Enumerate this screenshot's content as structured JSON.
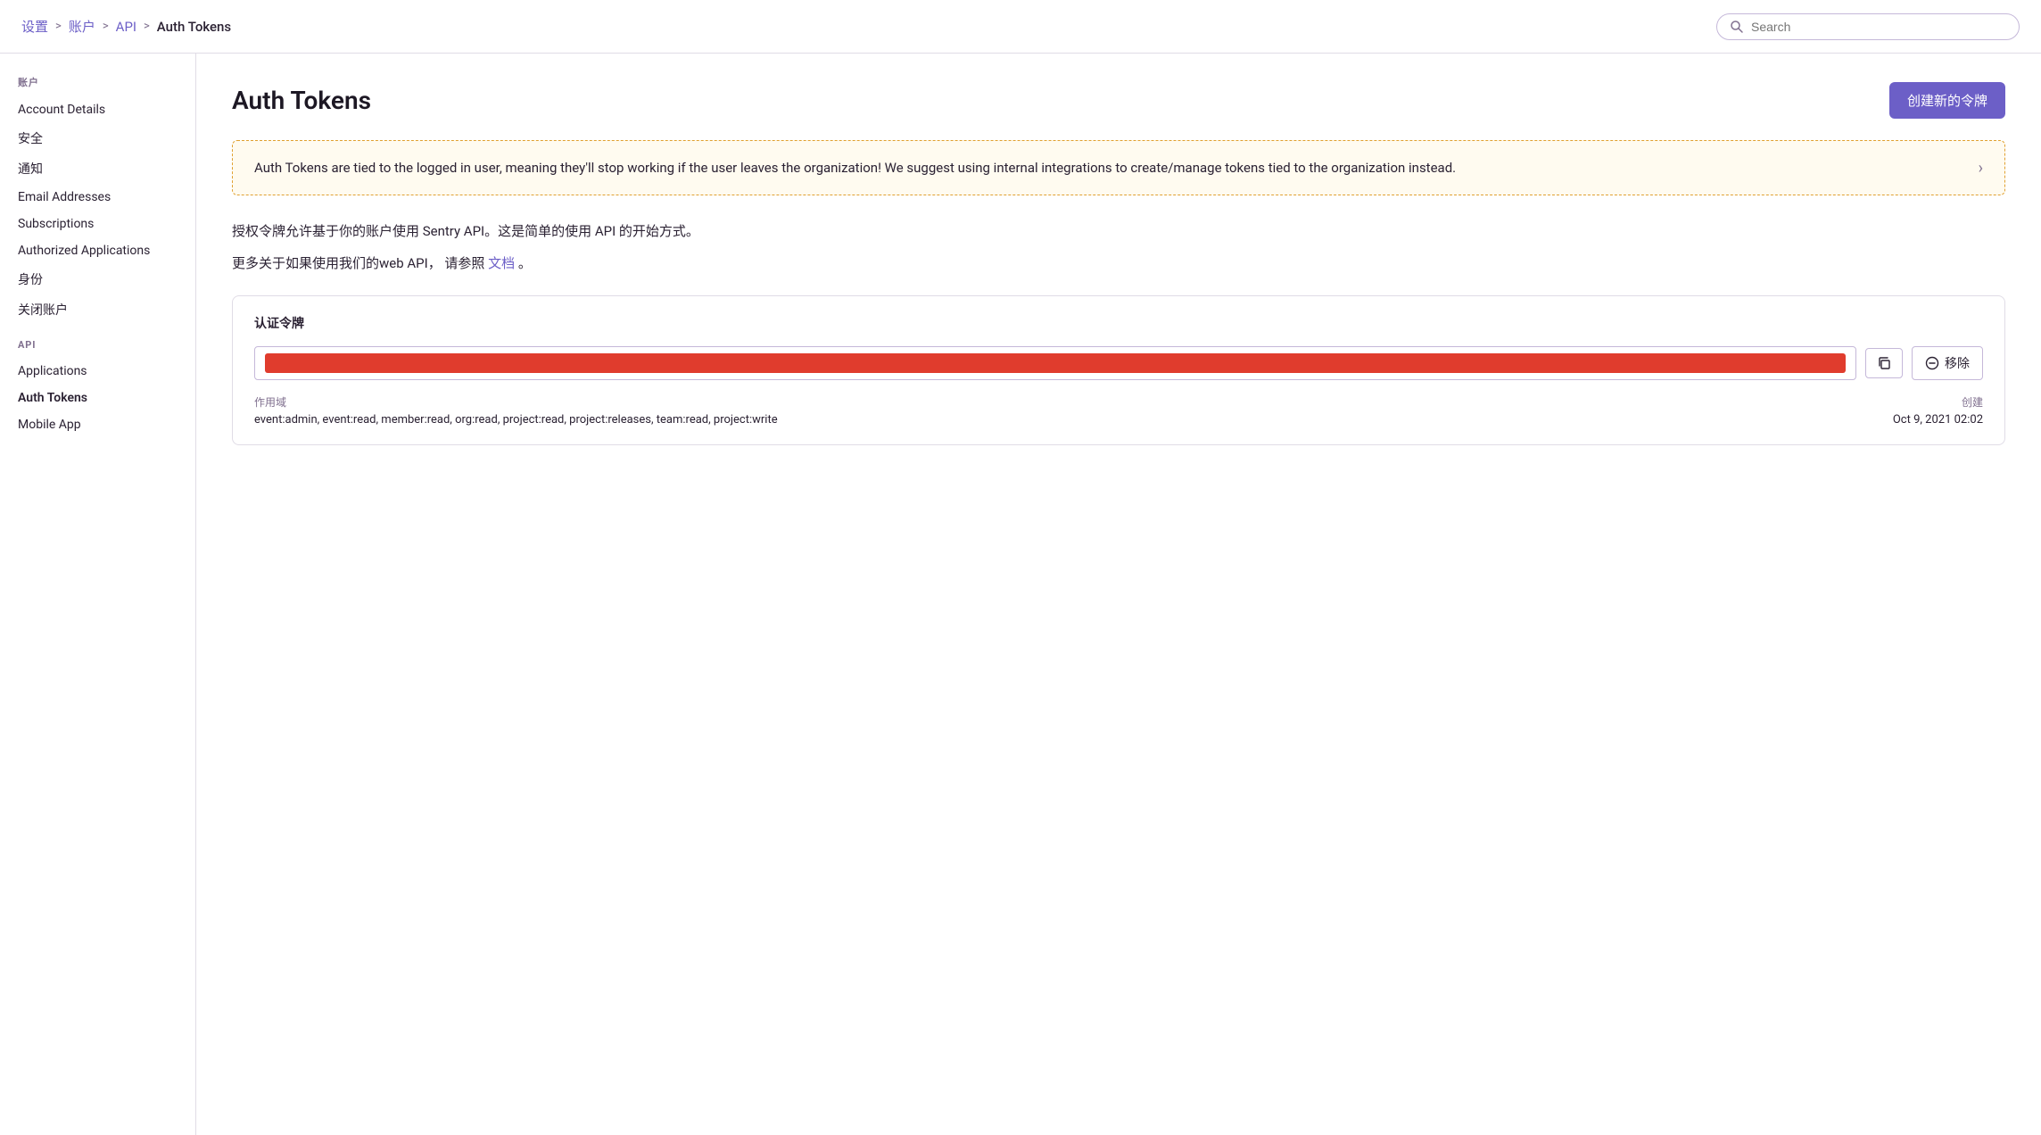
{
  "breadcrumb": {
    "items": [
      "设置",
      "账户",
      "API",
      "Auth Tokens"
    ],
    "separators": [
      ">",
      ">",
      ">"
    ]
  },
  "search": {
    "placeholder": "Search"
  },
  "sidebar": {
    "section1": {
      "title": "账户",
      "items": [
        {
          "id": "account-details",
          "label": "Account Details",
          "active": false
        },
        {
          "id": "security",
          "label": "安全",
          "active": false
        },
        {
          "id": "notifications",
          "label": "通知",
          "active": false
        },
        {
          "id": "email-addresses",
          "label": "Email Addresses",
          "active": false
        },
        {
          "id": "subscriptions",
          "label": "Subscriptions",
          "active": false
        },
        {
          "id": "authorized-applications",
          "label": "Authorized Applications",
          "active": false
        },
        {
          "id": "identity",
          "label": "身份",
          "active": false
        },
        {
          "id": "close-account",
          "label": "关闭账户",
          "active": false
        }
      ]
    },
    "section2": {
      "title": "API",
      "items": [
        {
          "id": "applications",
          "label": "Applications",
          "active": false
        },
        {
          "id": "auth-tokens",
          "label": "Auth Tokens",
          "active": true
        },
        {
          "id": "mobile-app",
          "label": "Mobile App",
          "active": false
        }
      ]
    }
  },
  "page": {
    "title": "Auth Tokens",
    "create_button": "创建新的令牌"
  },
  "alert": {
    "text": "Auth Tokens are tied to the logged in user, meaning they'll stop working if the user leaves the organization! We suggest using internal integrations to create/manage tokens tied to the organization instead.",
    "chevron": "›"
  },
  "description": {
    "line1": "授权令牌允许基于你的账户使用 Sentry API。这是简单的使用 API 的开始方式。",
    "line2_prefix": "更多关于如果使用我们的web API，  请参照",
    "link_text": "文档",
    "line2_suffix": "。"
  },
  "token_card": {
    "title": "认证令牌",
    "copy_icon": "⧉",
    "remove_icon": "⊖",
    "remove_label": "移除",
    "scope_label": "作用域",
    "scope_value": "event:admin, event:read, member:read, org:read, project:read, project:releases, team:read, project:write",
    "created_label": "创建",
    "created_value": "Oct 9, 2021 02:02"
  }
}
